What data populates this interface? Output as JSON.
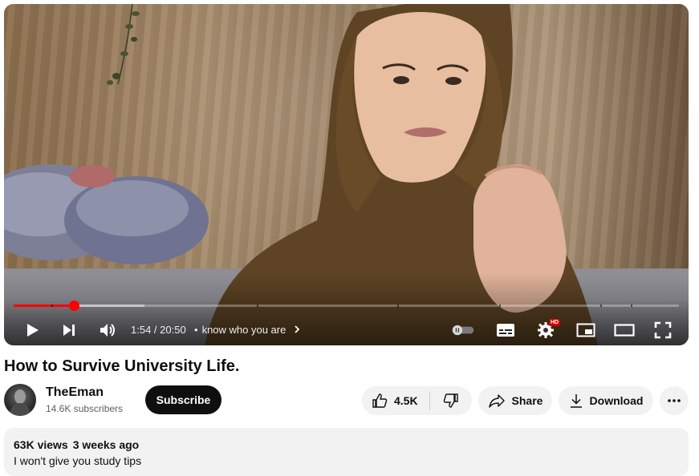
{
  "video": {
    "current_time": "1:54",
    "time_separator": " / ",
    "duration": "20:50",
    "chapter_title": "know who you are",
    "played_fraction": 0.091,
    "buffered_fraction": 0.197,
    "hd_badge": "HD",
    "accent_color": "#ff0000"
  },
  "title": "How to Survive University Life.",
  "channel": {
    "name": "TheEman",
    "subscribers": "14.6K subscribers",
    "subscribe_label": "Subscribe"
  },
  "actions": {
    "likes": "4.5K",
    "share_label": "Share",
    "download_label": "Download"
  },
  "description": {
    "views": "63K views",
    "date": "3 weeks ago",
    "text": "I won't give you study tips"
  },
  "icons": [
    "play-icon",
    "next-icon",
    "volume-icon",
    "chevron-right-icon",
    "autoplay-toggle-icon",
    "subtitles-icon",
    "settings-icon",
    "miniplayer-icon",
    "theater-mode-icon",
    "fullscreen-icon",
    "like-icon",
    "dislike-icon",
    "share-icon",
    "download-icon",
    "more-icon"
  ]
}
